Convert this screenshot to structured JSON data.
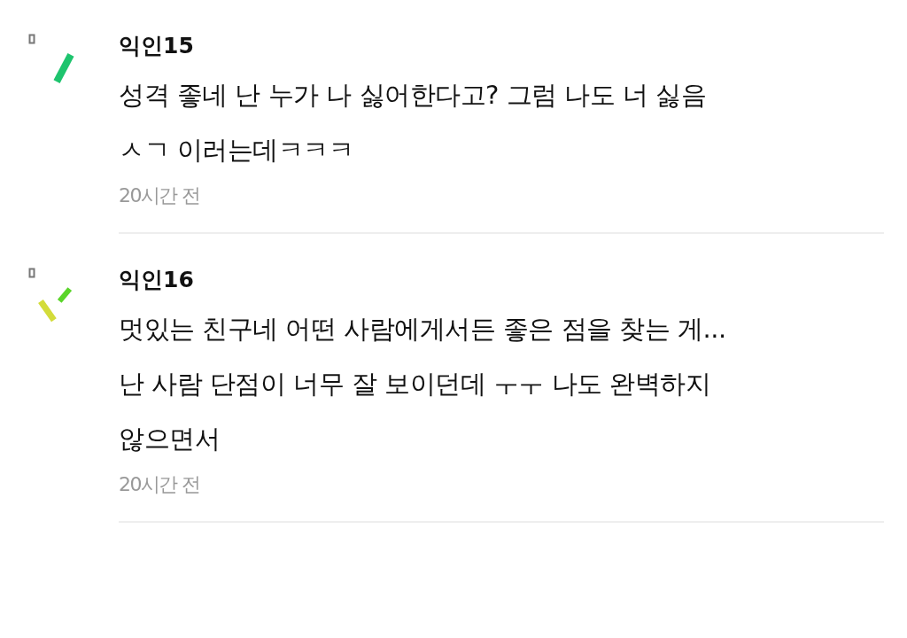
{
  "comments": [
    {
      "author": "익인15",
      "lines": [
        "성격 좋네 난 누가 나 싫어한다고? 그럼 나도 너 싫음",
        "ㅅㄱ 이러는데ㅋㅋㅋ"
      ],
      "time": "20시간 전"
    },
    {
      "author": "익인16",
      "lines": [
        "멋있는 친구네 어떤 사람에게서든 좋은 점을 찾는 게...",
        "난 사람 단점이 너무 잘 보이던데 ㅜㅜ 나도 완벽하지",
        "않으면서"
      ],
      "time": "20시간 전"
    }
  ]
}
